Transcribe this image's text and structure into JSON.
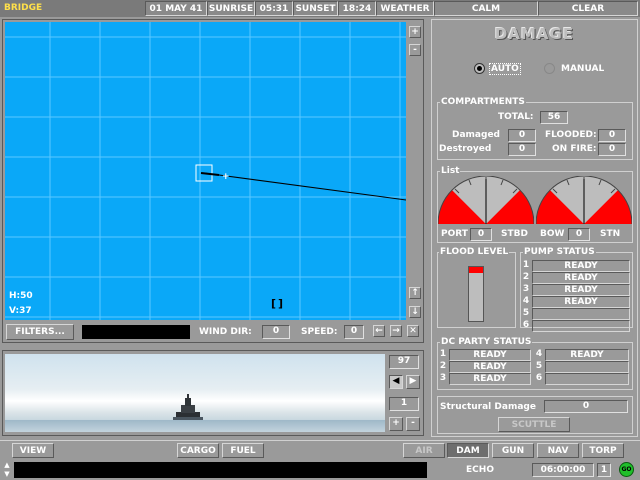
{
  "topbar": {
    "title": "BRIDGE",
    "date": "01 MAY 41",
    "sunrise_label": "SUNRISE",
    "sunrise_time": "05:31",
    "sunset_label": "SUNSET",
    "sunset_time": "18:24",
    "weather_label": "WEATHER",
    "weather_wind": "CALM",
    "weather_sky": "CLEAR"
  },
  "map": {
    "h_readout": "H:50",
    "v_readout": "V:37",
    "zoom_in": "+",
    "zoom_out": "-",
    "scroll_up": "↑",
    "scroll_down": "↓",
    "center_marker": "[]",
    "colors": {
      "sea": "#0aa8f8",
      "grid": "#5cc8ff"
    }
  },
  "filterbar": {
    "filters_label": "FILTERS...",
    "wind_dir_label": "WIND DIR:",
    "wind_dir_value": "0",
    "speed_label": "SPEED:",
    "speed_value": "0",
    "btn_left": "←",
    "btn_right": "→",
    "btn_close": "✕"
  },
  "view": {
    "heading_value": "97",
    "zoom_value": "1",
    "zoom_plus": "+",
    "zoom_minus": "-"
  },
  "damage": {
    "title": "DAMAGE",
    "mode_auto": "AUTO",
    "mode_manual": "MANUAL",
    "compartments_title": "COMPARTMENTS",
    "total_label": "TOTAL:",
    "total_value": "56",
    "damaged_label": "Damaged",
    "damaged_value": "0",
    "destroyed_label": "Destroyed",
    "destroyed_value": "0",
    "flooded_label": "FLOODED:",
    "flooded_value": "0",
    "onfire_label": "ON FIRE:",
    "onfire_value": "0",
    "list_title": "List",
    "port_label": "PORT",
    "port_value": "0",
    "stbd_label": "STBD",
    "bow_label": "BOW",
    "bow_value": "0",
    "stn_label": "STN",
    "flood_level_title": "FLOOD LEVEL",
    "flood_level_fraction": 0.12,
    "pump_status_title": "PUMP STATUS",
    "pumps": [
      {
        "num": "1",
        "status": "READY"
      },
      {
        "num": "2",
        "status": "READY"
      },
      {
        "num": "3",
        "status": "READY"
      },
      {
        "num": "4",
        "status": "READY"
      },
      {
        "num": "5",
        "status": ""
      },
      {
        "num": "6",
        "status": ""
      }
    ],
    "dc_party_title": "DC PARTY STATUS",
    "dc_left": [
      {
        "num": "1",
        "status": "READY"
      },
      {
        "num": "2",
        "status": "READY"
      },
      {
        "num": "3",
        "status": "READY"
      }
    ],
    "dc_right": [
      {
        "num": "4",
        "status": "READY"
      },
      {
        "num": "5",
        "status": ""
      },
      {
        "num": "6",
        "status": ""
      }
    ],
    "structural_label": "Structural Damage",
    "structural_value": "0",
    "scuttle_label": "SCUTTLE",
    "colors": {
      "gauge_fill": "#ff0000",
      "flood_fill": "#ff0000"
    }
  },
  "bottombar": {
    "view_label": "VIEW",
    "cargo_label": "CARGO",
    "fuel_label": "FUEL",
    "air_label": "AIR",
    "dam_label": "DAM",
    "gun_label": "GUN",
    "nav_label": "NAV",
    "torp_label": "TORP"
  },
  "statusbar": {
    "echo_label": "ECHO",
    "clock": "06:00:00",
    "speed_mult": "1",
    "go_label": "GO"
  }
}
